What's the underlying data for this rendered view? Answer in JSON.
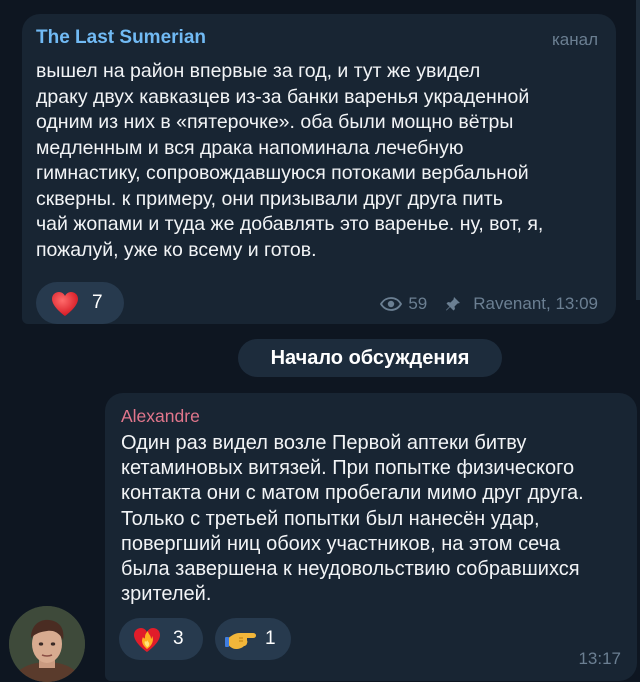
{
  "colors": {
    "background": "#0e1621",
    "bubble": "#182533",
    "channel_name": "#71baf4",
    "author_name": "#e1768c",
    "meta": "#6b7f92",
    "reaction_pill": "#273a4e"
  },
  "post": {
    "channel_name": "The Last Sumerian",
    "channel_tag": "канал",
    "text": "вышел на район впервые за год, и тут же увидел\nдраку двух кавказцев из-за банки варенья украденной\nодним из них в «пятерочке». оба были мощно вётры\nмедленным и вся драка напоминала лечебную\nгимнастику, сопровождавшуюся потоками вербальной\nскверны. к примеру, они призывали друг друга пить\nчай жопами и туда же добавлять это варенье. ну, вот, я,\nпожалуй, уже ко всему и готов.",
    "reaction": {
      "icon": "red-heart-icon",
      "count": "7"
    },
    "views": "59",
    "author_time": "Ravenant, 13:09",
    "view_icon": "eye-icon",
    "pin_icon": "pushpin-icon"
  },
  "divider": {
    "label": "Начало обсуждения"
  },
  "comment": {
    "author": "Alexandre",
    "avatar_icon": "user-avatar",
    "text": "Один раз видел возле Первой аптеки   битву\nкетаминовых витязей. При попытке физического\nконтакта они с матом пробегали мимо друг друга.\nТолько с третьей попытки был нанесён удар,\nповергший ниц обоих участников, на этом сеча\nбыла завершена к неудовольствию собравшихся\nзрителей.",
    "reactions": [
      {
        "icon": "heart-on-fire-icon",
        "count": "3"
      },
      {
        "icon": "pointing-hand-icon",
        "count": "1"
      }
    ],
    "time": "13:17"
  }
}
